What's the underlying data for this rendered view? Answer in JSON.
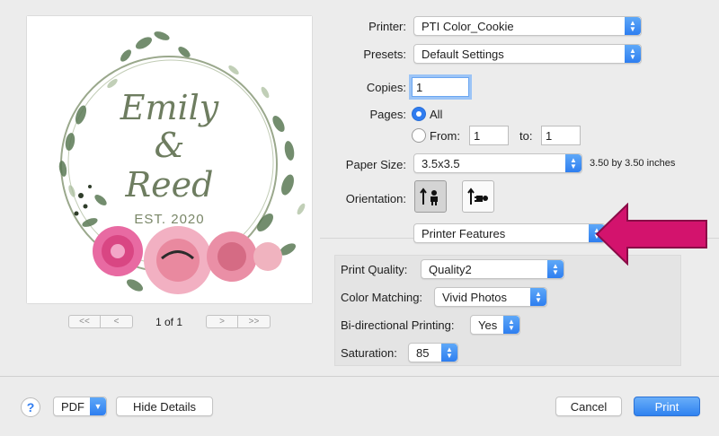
{
  "preview": {
    "line1": "Emily",
    "line2": "&",
    "line3": "Reed",
    "line4": "EST. 2020",
    "page_of": "1 of 1",
    "first_label": "<<",
    "prev_label": "<",
    "next_label": ">",
    "last_label": ">>"
  },
  "printer": {
    "label": "Printer:",
    "value": "PTI Color_Cookie"
  },
  "presets": {
    "label": "Presets:",
    "value": "Default Settings"
  },
  "copies": {
    "label": "Copies:",
    "value": "1"
  },
  "pages": {
    "label": "Pages:",
    "all_label": "All",
    "from_label": "From:",
    "from_value": "1",
    "to_label": "to:",
    "to_value": "1"
  },
  "paper_size": {
    "label": "Paper Size:",
    "value": "3.5x3.5",
    "dimensions": "3.50 by 3.50 inches"
  },
  "orientation": {
    "label": "Orientation:",
    "portrait_icon": "portrait-orientation-icon",
    "landscape_icon": "landscape-orientation-icon"
  },
  "section": {
    "value": "Printer Features"
  },
  "features": {
    "print_quality": {
      "label": "Print Quality:",
      "value": "Quality2"
    },
    "color_matching": {
      "label": "Color Matching:",
      "value": "Vivid Photos"
    },
    "bidirectional": {
      "label": "Bi-directional Printing:",
      "value": "Yes"
    },
    "saturation": {
      "label": "Saturation:",
      "value": "85"
    }
  },
  "footer": {
    "help_label": "?",
    "pdf_label": "PDF",
    "hide_details_label": "Hide Details",
    "cancel_label": "Cancel",
    "print_label": "Print"
  },
  "colors": {
    "accent": "#2f7cf0",
    "arrow": "#d3136d"
  }
}
